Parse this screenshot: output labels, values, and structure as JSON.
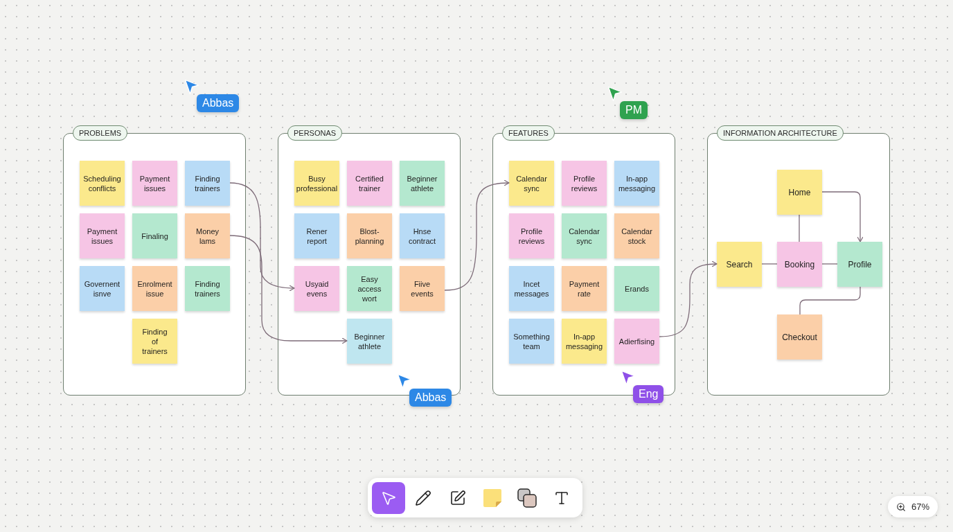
{
  "frames": [
    {
      "kind": "notes",
      "title": "PROBLEMS",
      "notes": [
        {
          "text": "Scheduling\nconflicts",
          "color": "#fbe98c"
        },
        {
          "text": "Payment\nissues",
          "color": "#f6c5e5"
        },
        {
          "text": "Finding\ntrainers",
          "color": "#b8dbf6"
        },
        {
          "text": "Payment\nissues",
          "color": "#f6c5e5"
        },
        {
          "text": "Finaling",
          "color": "#b4e8cf"
        },
        {
          "text": "Money\nlams",
          "color": "#fbcfa8"
        },
        {
          "text": "Governent\nisnve",
          "color": "#b8dbf6"
        },
        {
          "text": "Enrolment\nissue",
          "color": "#fbcfa8"
        },
        {
          "text": "Finding\ntrainers",
          "color": "#b4e8cf"
        },
        {
          "text": "Finding\nof\ntrainers",
          "color": "#fbe98c"
        }
      ]
    },
    {
      "kind": "notes",
      "title": "PERSONAS",
      "notes": [
        {
          "text": "Busy\nprofessional",
          "color": "#fbe98c"
        },
        {
          "text": "Certified\ntrainer",
          "color": "#f6c5e5"
        },
        {
          "text": "Beginner\nathlete",
          "color": "#b4e8cf"
        },
        {
          "text": "Rener\nreport",
          "color": "#b8dbf6"
        },
        {
          "text": "Blost-\nplanning",
          "color": "#fbcfa8"
        },
        {
          "text": "Hnse\ncontract",
          "color": "#b8dbf6"
        },
        {
          "text": "Usyaid\nevens",
          "color": "#f6c5e5"
        },
        {
          "text": "Easy\naccess\nwort",
          "color": "#b4e8cf"
        },
        {
          "text": "Fiive\nevents",
          "color": "#fbcfa8"
        },
        {
          "text": "Beginner\nathlete",
          "color": "#bfe6f0"
        }
      ]
    },
    {
      "kind": "notes",
      "title": "FEATURES",
      "notes": [
        {
          "text": "Calendar\nsync",
          "color": "#fbe98c"
        },
        {
          "text": "Profile\nreviews",
          "color": "#f6c5e5"
        },
        {
          "text": "In-app\nmessaging",
          "color": "#b8dbf6"
        },
        {
          "text": "Profile\nreviews",
          "color": "#f6c5e5"
        },
        {
          "text": "Calendar\nsync",
          "color": "#b4e8cf"
        },
        {
          "text": "Calendar\nstock",
          "color": "#fbcfa8"
        },
        {
          "text": "Incet\nmessages",
          "color": "#b8dbf6"
        },
        {
          "text": "Payment\nrate",
          "color": "#fbcfa8"
        },
        {
          "text": "Erands",
          "color": "#b4e8cf"
        },
        {
          "text": "Something\nteam",
          "color": "#b8dbf6"
        },
        {
          "text": "In-app\nmessaging",
          "color": "#fbe98c"
        },
        {
          "text": "Adierfising",
          "color": "#f6c5e5"
        }
      ]
    },
    {
      "kind": "diagram",
      "title": "INFORMATION ARCHITECTURE",
      "nodes": [
        {
          "text": "Home",
          "color": "#fbe98c"
        },
        {
          "text": "Search",
          "color": "#fbe98c"
        },
        {
          "text": "Booking",
          "color": "#f6c5e5"
        },
        {
          "text": "Profile",
          "color": "#b4e8cf"
        },
        {
          "text": "Checkout",
          "color": "#fbcfa8"
        }
      ]
    }
  ],
  "cursors": [
    {
      "name": "Abbas",
      "color": "#2d88e6"
    },
    {
      "name": "PM",
      "color": "#2fa24f"
    },
    {
      "name": "Abbas",
      "color": "#2d88e6"
    },
    {
      "name": "Eng",
      "color": "#8f50e8"
    }
  ],
  "toolbar": {
    "tools": [
      {
        "kind": "select",
        "selected": true
      },
      {
        "kind": "pencil",
        "selected": false
      },
      {
        "kind": "frame",
        "selected": false
      },
      {
        "kind": "sticky",
        "selected": false
      },
      {
        "kind": "shapes",
        "selected": false
      },
      {
        "kind": "text",
        "selected": false
      }
    ]
  },
  "zoom": {
    "label": "67%"
  }
}
